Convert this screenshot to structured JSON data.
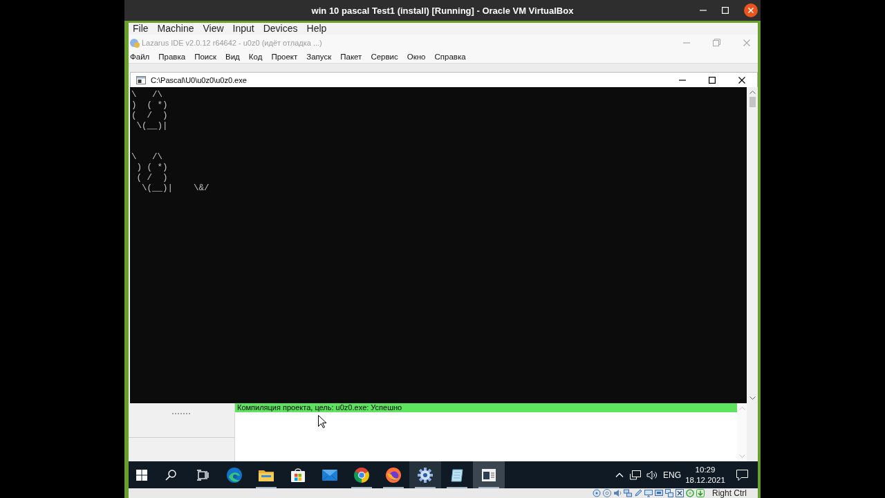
{
  "window": {
    "title": "win 10 pascal Test1 (install) [Running] - Oracle VM VirtualBox"
  },
  "menu": [
    "File",
    "Machine",
    "View",
    "Input",
    "Devices",
    "Help"
  ],
  "ide": {
    "title": "Lazarus IDE v2.0.12 r64642 - u0z0 (идёт отладка ...)",
    "active": false,
    "menu": [
      "Файл",
      "Правка",
      "Поиск",
      "Вид",
      "Код",
      "Проект",
      "Запуск",
      "Пакет",
      "Сервис",
      "Окно",
      "Справка"
    ],
    "messages": [
      {
        "text": "Компиляция проекта, цель: u0z0.exe: Успешно",
        "kind": "success"
      }
    ]
  },
  "console": {
    "title": "C:\\Pascal\\U0\\u0z0\\u0z0.exe",
    "blocks": [
      [
        "\\   /\\",
        ")  ( *)",
        "(  /  )",
        " \\(__)|"
      ],
      [
        "\\   /\\",
        " ) ( *)",
        " ( /  )",
        "  \\(__)|    \\&/"
      ]
    ]
  },
  "taskbar": {
    "apps": [
      {
        "running": false,
        "highlighted": false,
        "selected": false
      },
      {
        "running": true,
        "highlighted": false,
        "selected": false
      },
      {
        "running": false,
        "highlighted": false,
        "selected": false
      },
      {
        "running": false,
        "highlighted": false,
        "selected": false
      },
      {
        "running": true,
        "highlighted": false,
        "selected": false
      },
      {
        "running": true,
        "highlighted": false,
        "selected": false
      },
      {
        "running": true,
        "highlighted": true,
        "selected": false
      },
      {
        "running": true,
        "highlighted": false,
        "selected": false
      },
      {
        "running": true,
        "highlighted": false,
        "selected": true
      }
    ],
    "tray": {
      "language": "ENG",
      "time": "10:29",
      "date": "18.12.2021"
    }
  },
  "status_bar": {
    "host_key": "Right Ctrl"
  }
}
